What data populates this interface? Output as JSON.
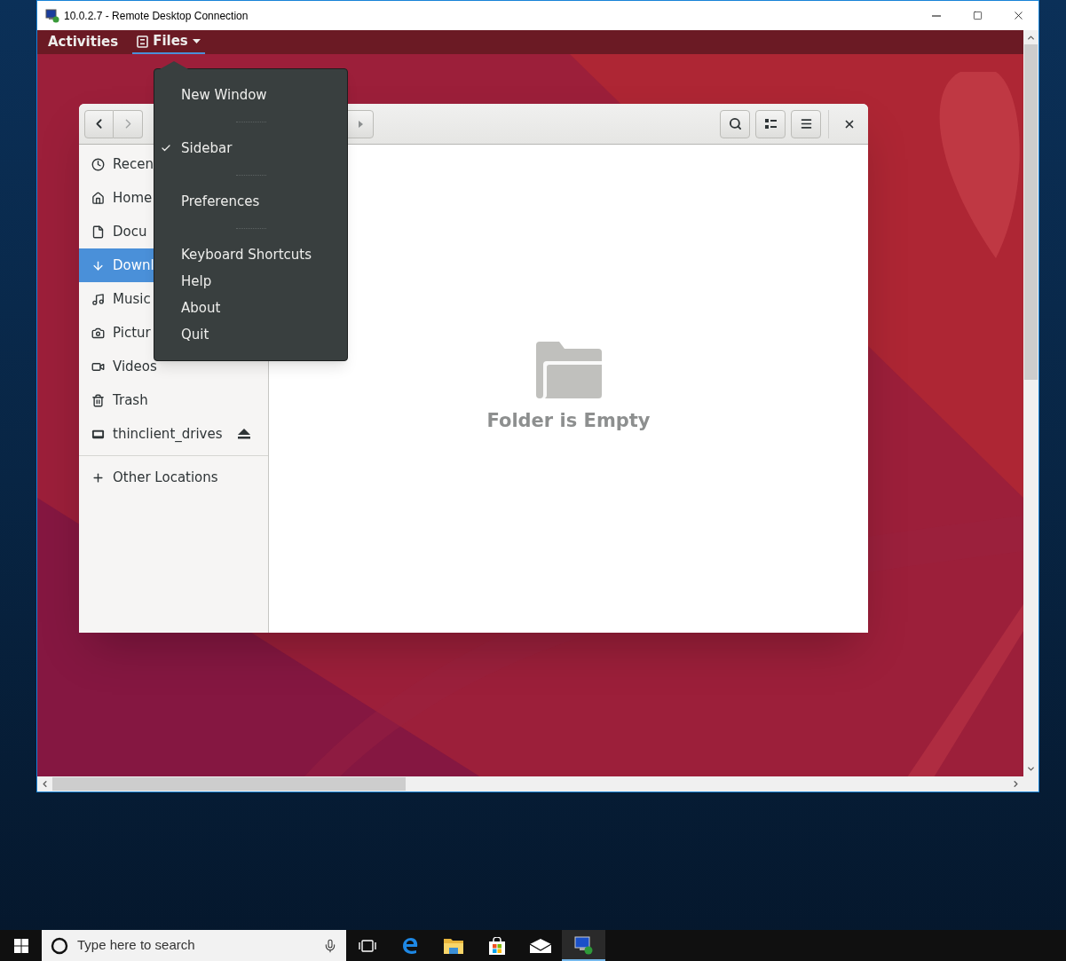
{
  "rdp_window": {
    "title": "10.0.2.7 - Remote Desktop Connection"
  },
  "top_bar": {
    "activities": "Activities",
    "app_menu": {
      "label": "Files",
      "selected": true
    }
  },
  "app_menu": {
    "items": [
      {
        "kind": "item",
        "label": "New Window",
        "checked": false
      },
      {
        "kind": "separator"
      },
      {
        "kind": "item",
        "label": "Sidebar",
        "checked": true
      },
      {
        "kind": "separator"
      },
      {
        "kind": "item",
        "label": "Preferences",
        "checked": false
      },
      {
        "kind": "separator"
      },
      {
        "kind": "item",
        "label": "Keyboard Shortcuts",
        "checked": false
      },
      {
        "kind": "item",
        "label": "Help",
        "checked": false
      },
      {
        "kind": "item",
        "label": "About",
        "checked": false
      },
      {
        "kind": "item",
        "label": "Quit",
        "checked": false
      }
    ]
  },
  "files_window": {
    "sidebar": {
      "items": [
        {
          "label": "Recen",
          "selected": false
        },
        {
          "label": "Home",
          "selected": false
        },
        {
          "label": "Docu",
          "selected": false
        },
        {
          "label": "Downl",
          "selected": true
        },
        {
          "label": "Music",
          "selected": false
        },
        {
          "label": "Pictur",
          "selected": false
        },
        {
          "label": "Videos",
          "selected": false
        },
        {
          "label": "Trash",
          "selected": false
        },
        {
          "label": "thinclient_drives",
          "selected": false
        }
      ],
      "other_locations": "Other Locations"
    },
    "empty_state": "Folder is Empty"
  },
  "taskbar": {
    "search_placeholder": "Type here to search"
  }
}
